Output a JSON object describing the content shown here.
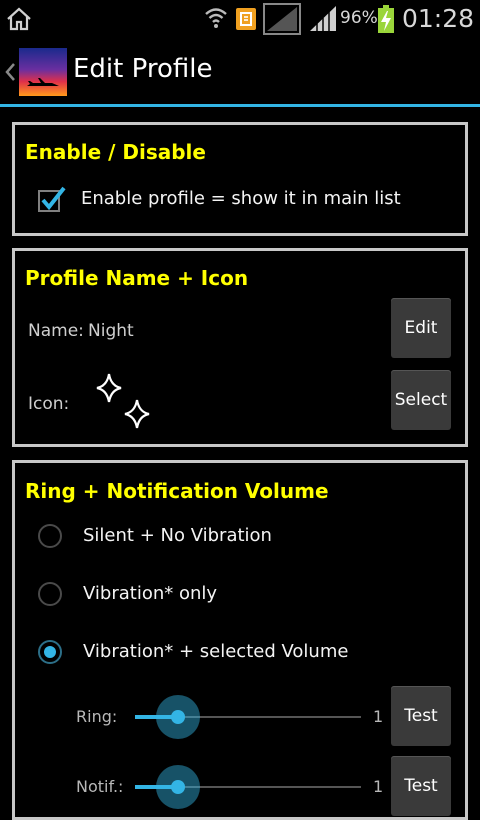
{
  "status_bar": {
    "battery_percent": "96%",
    "time": "01:28",
    "icons": [
      "home-icon",
      "wifi-icon",
      "notification-icon",
      "signal-empty-icon",
      "signal-icon",
      "battery-charging-icon"
    ]
  },
  "action_bar": {
    "title": "Edit Profile",
    "back_icon": "chevron-left-icon",
    "app_icon": "airplane-sunset-icon"
  },
  "enable_card": {
    "title": "Enable / Disable",
    "checkbox_label": "Enable profile = show it in main list",
    "checked": true
  },
  "profile_card": {
    "title": "Profile Name + Icon",
    "name_label": "Name:",
    "name_value": "Night",
    "edit_button": "Edit",
    "icon_label": "Icon:",
    "profile_icon": "sparkles-icon",
    "select_button": "Select"
  },
  "volume_card": {
    "title": "Ring + Notification Volume",
    "options": [
      {
        "label": "Silent + No Vibration",
        "selected": false
      },
      {
        "label": "Vibration* only",
        "selected": false
      },
      {
        "label": "Vibration* + selected Volume",
        "selected": true
      }
    ],
    "sliders": [
      {
        "label": "Ring:",
        "value": "1",
        "level": 1,
        "max": 7,
        "test_button": "Test"
      },
      {
        "label": "Notif.:",
        "value": "1",
        "level": 1,
        "max": 7,
        "test_button": "Test"
      }
    ]
  },
  "colors": {
    "accent": "#33b5e5",
    "heading": "#ffff00",
    "border": "#c8c8c8",
    "background": "#000000"
  }
}
